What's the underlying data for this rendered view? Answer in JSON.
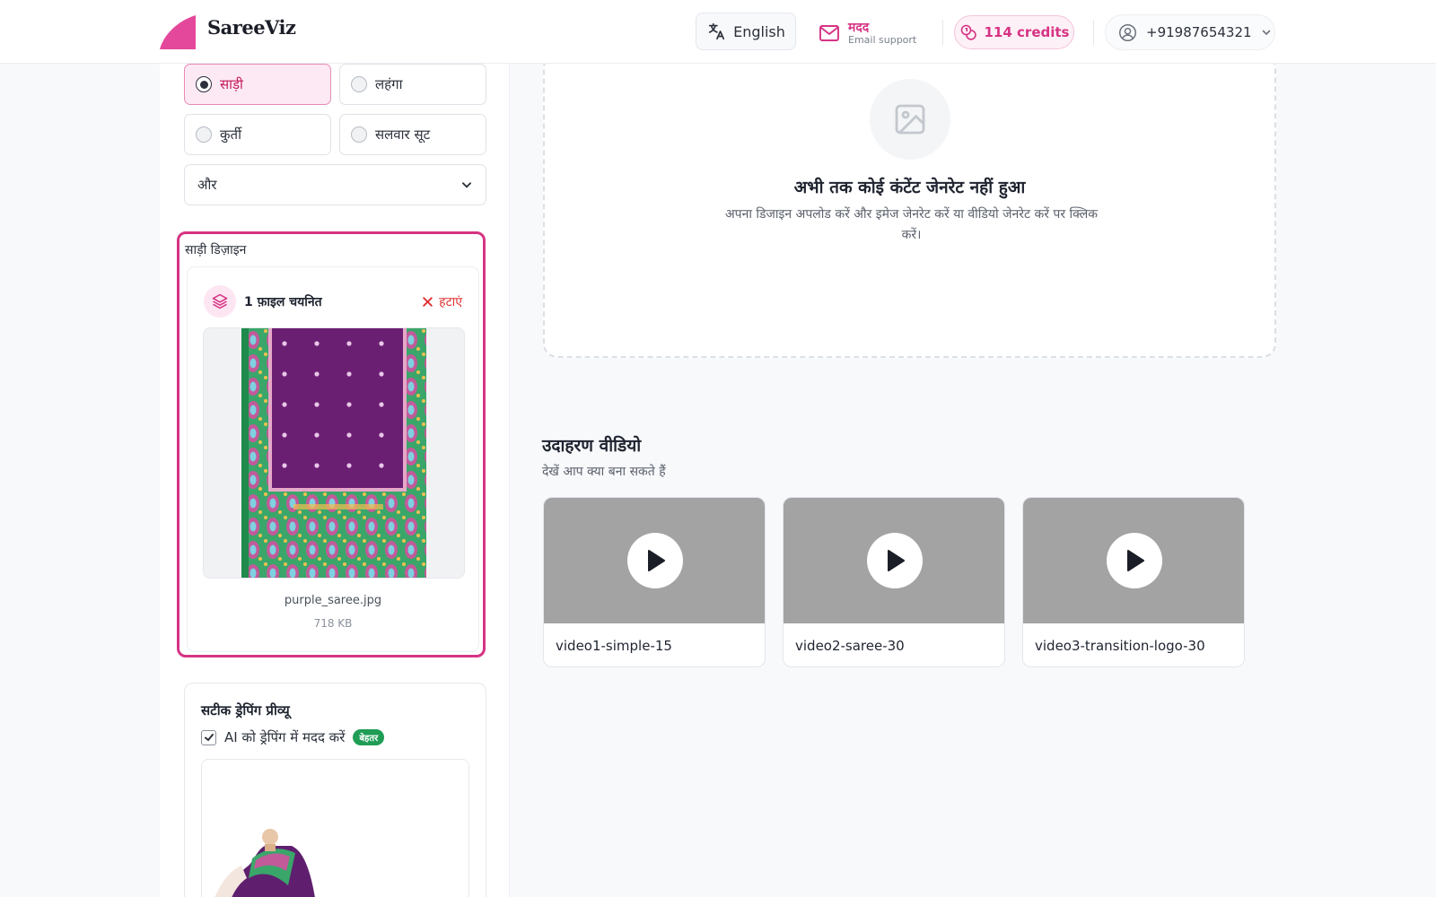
{
  "brand": {
    "name": "SareeViz",
    "accent": "#d63384"
  },
  "header": {
    "language_label": "English",
    "help_title": "मदद",
    "help_sub": "Email support",
    "credits_label": "114 credits",
    "account_phone": "+91987654321"
  },
  "garment": {
    "options": [
      {
        "label": "साड़ी",
        "selected": true
      },
      {
        "label": "लहंगा",
        "selected": false
      },
      {
        "label": "कुर्ती",
        "selected": false
      },
      {
        "label": "सलवार सूट",
        "selected": false
      }
    ],
    "more_label": "और"
  },
  "design": {
    "label": "साड़ी डिज़ाइन",
    "selected_count": "1 फ़ाइल चयनित",
    "remove_label": "हटाएं",
    "file_name": "purple_saree.jpg",
    "file_size": "718 KB"
  },
  "drape": {
    "title": "सटीक ड्रेपिंग प्रीव्यू",
    "checkbox_label": "AI को ड्रेपिंग में मदद करें",
    "checked": true,
    "badge": "बेहतर"
  },
  "empty_state": {
    "title": "अभी तक कोई कंटेंट जेनरेट नहीं हुआ",
    "description": "अपना डिजाइन अपलोड करें और इमेज जेनरेट करें या वीडियो जेनरेट करें पर क्लिक करें।"
  },
  "examples": {
    "title": "उदाहरण वीडियो",
    "subtitle": "देखें आप क्या बना सकते हैं",
    "videos": [
      {
        "label": "video1-simple-15"
      },
      {
        "label": "video2-saree-30"
      },
      {
        "label": "video3-transition-logo-30"
      }
    ]
  }
}
